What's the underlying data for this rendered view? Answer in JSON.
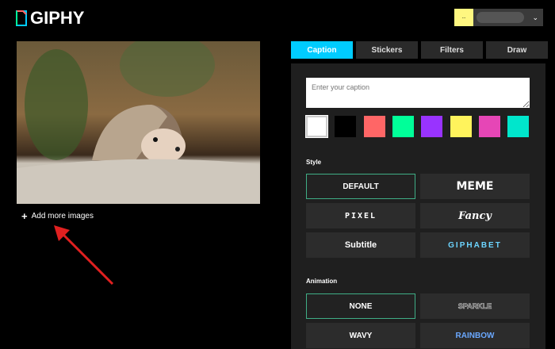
{
  "header": {
    "logo": "GIPHY",
    "avatar": "..",
    "chevron": "⌄"
  },
  "left": {
    "add_more": "Add more images",
    "add_icon": "+"
  },
  "tabs": [
    {
      "label": "Caption",
      "active": true
    },
    {
      "label": "Stickers"
    },
    {
      "label": "Filters"
    },
    {
      "label": "Draw"
    }
  ],
  "caption": {
    "placeholder": "Enter your caption"
  },
  "swatches": [
    "#ffffff",
    "#000000",
    "#ff6666",
    "#00ff99",
    "#9933ff",
    "#fff35c",
    "#e646b6",
    "#00e6cc"
  ],
  "style": {
    "label": "Style",
    "options": [
      "DEFAULT",
      "MEME",
      "PIXEL",
      "Fancy",
      "Subtitle",
      "GIPHABET"
    ],
    "selected": "DEFAULT"
  },
  "animation": {
    "label": "Animation",
    "options": [
      "NONE",
      "SPARKLE",
      "WAVY",
      "RAINBOW"
    ],
    "selected": "NONE"
  }
}
